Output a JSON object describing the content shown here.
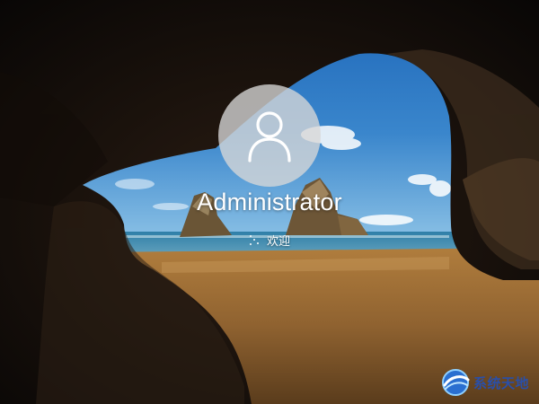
{
  "login": {
    "user_name": "Administrator",
    "status_text": "欢迎",
    "avatar_icon": "user-silhouette-icon",
    "spinner_icon": "loading-dots-icon"
  },
  "watermark": {
    "text": "系统天地",
    "logo_icon": "globe-logo-icon",
    "color": "#2a4fa8"
  }
}
